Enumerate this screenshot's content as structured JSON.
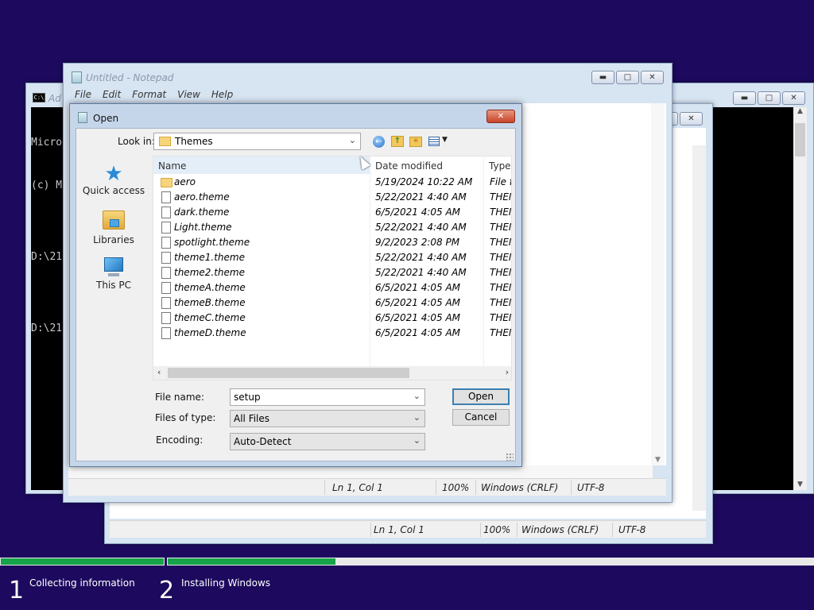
{
  "console": {
    "title": "Ad",
    "lines": [
      "Micro",
      "(c) M",
      "",
      "D:\\21",
      "",
      "D:\\21"
    ]
  },
  "notepad_back": {
    "status": {
      "pos": "Ln 1, Col 1",
      "zoom": "100%",
      "eol": "Windows (CRLF)",
      "enc": "UTF-8"
    }
  },
  "notepad": {
    "title": "Untitled - Notepad",
    "menu": [
      "File",
      "Edit",
      "Format",
      "View",
      "Help"
    ],
    "status": {
      "pos": "Ln 1, Col 1",
      "zoom": "100%",
      "eol": "Windows (CRLF)",
      "enc": "UTF-8"
    }
  },
  "dialog": {
    "title": "Open",
    "look_in_label": "Look in:",
    "look_in_value": "Themes",
    "places": [
      "Quick access",
      "Libraries",
      "This PC"
    ],
    "columns": {
      "name": "Name",
      "date": "Date modified",
      "type": "Type"
    },
    "files": [
      {
        "name": "aero",
        "date": "5/19/2024 10:22 AM",
        "type": "File fo",
        "folder": true
      },
      {
        "name": "aero.theme",
        "date": "5/22/2021 4:40 AM",
        "type": "THEM"
      },
      {
        "name": "dark.theme",
        "date": "6/5/2021 4:05 AM",
        "type": "THEM"
      },
      {
        "name": "Light.theme",
        "date": "5/22/2021 4:40 AM",
        "type": "THEM"
      },
      {
        "name": "spotlight.theme",
        "date": "9/2/2023 2:08 PM",
        "type": "THEM"
      },
      {
        "name": "theme1.theme",
        "date": "5/22/2021 4:40 AM",
        "type": "THEM"
      },
      {
        "name": "theme2.theme",
        "date": "5/22/2021 4:40 AM",
        "type": "THEM"
      },
      {
        "name": "themeA.theme",
        "date": "6/5/2021 4:05 AM",
        "type": "THEM"
      },
      {
        "name": "themeB.theme",
        "date": "6/5/2021 4:05 AM",
        "type": "THEM"
      },
      {
        "name": "themeC.theme",
        "date": "6/5/2021 4:05 AM",
        "type": "THEM"
      },
      {
        "name": "themeD.theme",
        "date": "6/5/2021 4:05 AM",
        "type": "THEM"
      }
    ],
    "file_name_label": "File name:",
    "file_name_value": "setup",
    "file_type_label": "Files of type:",
    "file_type_value": "All Files",
    "encoding_label": "Encoding:",
    "encoding_value": "Auto-Detect",
    "open_label": "Open",
    "cancel_label": "Cancel"
  },
  "setup_progress": {
    "steps": [
      {
        "number": "1",
        "label": "Collecting information",
        "progress": 1.0
      },
      {
        "number": "2",
        "label": "Installing Windows",
        "progress": 0.26
      }
    ]
  },
  "colors": {
    "background": "#1d0a5e",
    "progress_fill": "#16a34a",
    "close_button": "#c6452a"
  },
  "icons": [
    "console-icon",
    "notepad-icon",
    "star-icon",
    "libraries-icon",
    "computer-icon",
    "folder-icon",
    "file-icon",
    "back-icon",
    "up-folder-icon",
    "new-folder-icon",
    "view-menu-icon",
    "chevron-down-icon",
    "chevron-up-icon",
    "minimize-icon",
    "maximize-icon",
    "close-icon",
    "mouse-cursor-icon"
  ]
}
